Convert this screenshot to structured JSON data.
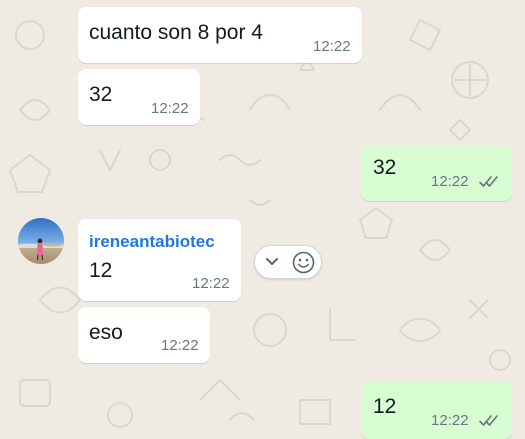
{
  "chat": {
    "background_color": "#efeae2",
    "incoming_bubble_color": "#ffffff",
    "outgoing_bubble_color": "#d9fdd3",
    "sender_name_color": "#1f7ae0",
    "read_tick_color": "#667781",
    "messages": [
      {
        "direction": "incoming",
        "text": "cuanto son 8 por 4",
        "time": "12:22"
      },
      {
        "direction": "incoming",
        "text": "32",
        "time": "12:22"
      },
      {
        "direction": "outgoing",
        "text": "32",
        "time": "12:22",
        "status_icon": "double-check-icon"
      },
      {
        "direction": "incoming",
        "author": "ireneantabiotec",
        "text": "12",
        "time": "12:22",
        "avatar_icon": "contact-avatar"
      },
      {
        "direction": "incoming",
        "text": "eso",
        "time": "12:22"
      },
      {
        "direction": "outgoing",
        "text": "12",
        "time": "12:22",
        "status_icon": "double-check-icon"
      }
    ]
  },
  "message_actions": {
    "menu_icon": "chevron-down-icon",
    "react_icon": "smiley-icon"
  }
}
